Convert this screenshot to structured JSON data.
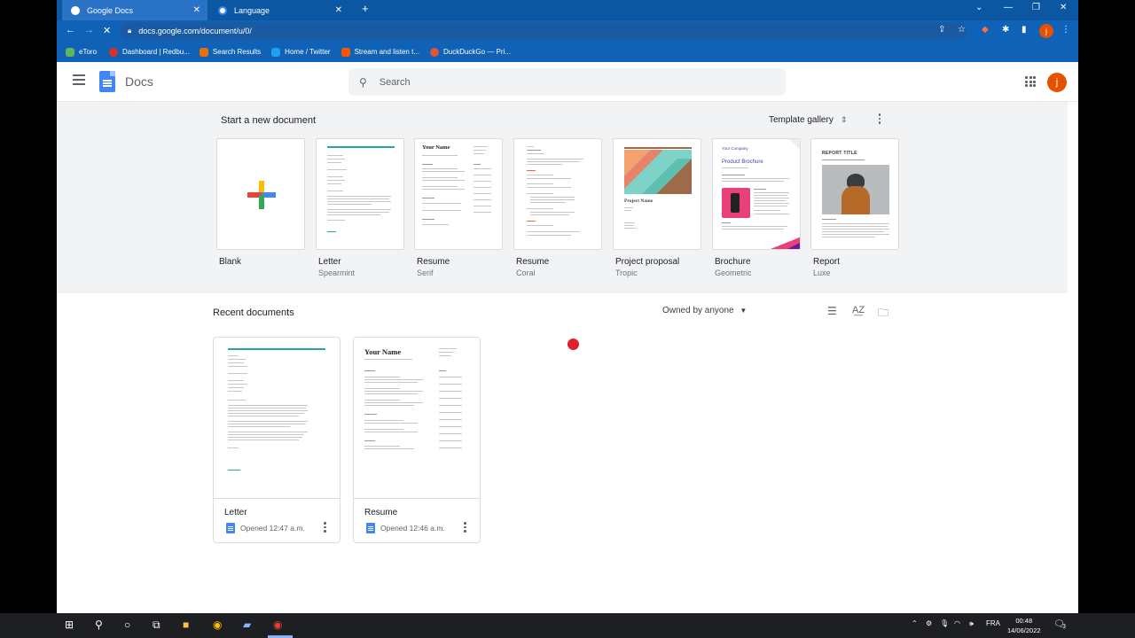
{
  "browser": {
    "tabs": [
      {
        "title": "Google Docs",
        "active": true
      },
      {
        "title": "Language",
        "active": false
      }
    ],
    "url": "docs.google.com/document/u/0/",
    "profile_initial": "j",
    "bookmarks": [
      {
        "label": "eToro",
        "color": "#5cb85c"
      },
      {
        "label": "Dashboard | Redbu...",
        "color": "#d93025"
      },
      {
        "label": "Search Results",
        "color": "#e8710a"
      },
      {
        "label": "Home / Twitter",
        "color": "#1da1f2"
      },
      {
        "label": "Stream and listen t...",
        "color": "#ff5500"
      },
      {
        "label": "DuckDuckGo — Pri...",
        "color": "#de5833"
      }
    ]
  },
  "app": {
    "name": "Docs",
    "search_placeholder": "Search",
    "avatar_initial": "j"
  },
  "start_section": {
    "title": "Start a new document",
    "gallery_label": "Template gallery",
    "templates": [
      {
        "name": "Blank",
        "sub": ""
      },
      {
        "name": "Letter",
        "sub": "Spearmint"
      },
      {
        "name": "Resume",
        "sub": "Serif"
      },
      {
        "name": "Resume",
        "sub": "Coral"
      },
      {
        "name": "Project proposal",
        "sub": "Tropic"
      },
      {
        "name": "Brochure",
        "sub": "Geometric"
      },
      {
        "name": "Report",
        "sub": "Luxe"
      }
    ],
    "thumb_text": {
      "serif_name": "Your Name",
      "project_name": "Project Name",
      "brochure_company": "Your Company",
      "brochure_title": "Product Brochure",
      "report_title": "REPORT TITLE"
    }
  },
  "recent_section": {
    "title": "Recent documents",
    "owner_filter": "Owned by anyone",
    "documents": [
      {
        "name": "Letter",
        "meta": "Opened 12:47 a.m."
      },
      {
        "name": "Resume",
        "meta": "Opened 12:46 a.m.",
        "thumb_heading": "Your Name"
      }
    ]
  },
  "taskbar": {
    "language": "FRA",
    "time": "00:48",
    "date": "14/06/2022",
    "notifications": "3"
  },
  "colors": {
    "chrome_blue": "#0f62b5",
    "docs_blue": "#4285f4",
    "indicator_red": "#e0202a"
  }
}
